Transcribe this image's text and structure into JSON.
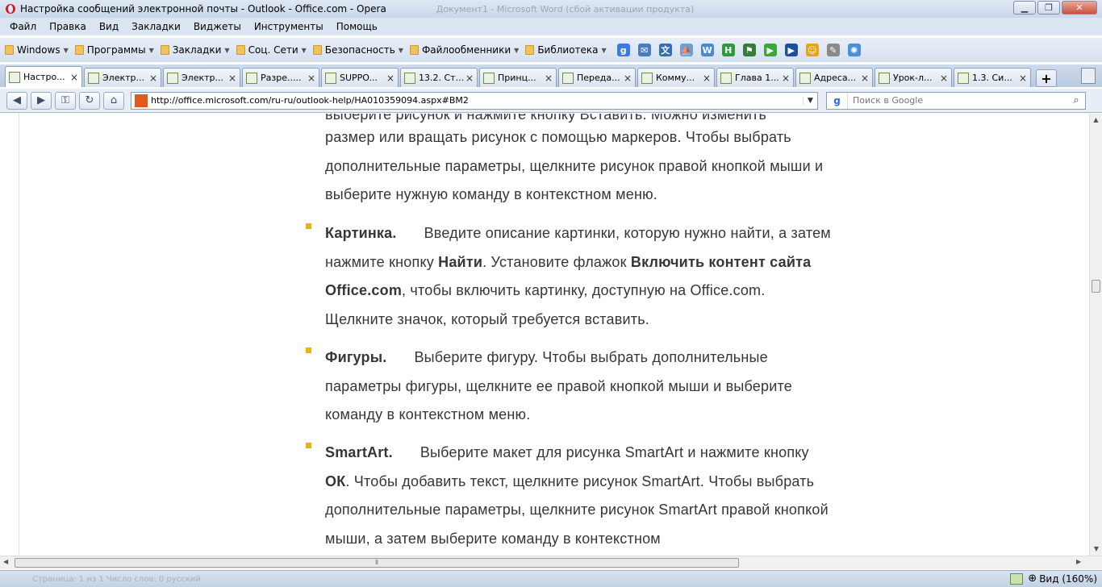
{
  "window": {
    "title": "Настройка сообщений электронной почты - Outlook - Office.com - Opera",
    "ghost_title": "Документ1 - Microsoft Word (сбой активации продукта)",
    "minimize": "▁",
    "maximize": "❐",
    "close": "✕"
  },
  "menu": [
    "Файл",
    "Правка",
    "Вид",
    "Закладки",
    "Виджеты",
    "Инструменты",
    "Помощь"
  ],
  "bookmarks": {
    "folders": [
      "Windows",
      "Программы",
      "Закладки",
      "Соц. Сети",
      "Безопасность",
      "Файлообменники",
      "Библиотека"
    ],
    "icons": [
      {
        "name": "google-icon",
        "glyph": "g",
        "color": "#3d7be0"
      },
      {
        "name": "mail-icon",
        "glyph": "✉",
        "color": "#4a7dc0"
      },
      {
        "name": "translate-icon",
        "glyph": "文",
        "color": "#2f6fb8"
      },
      {
        "name": "sail-icon",
        "glyph": "⛵",
        "color": "#6aa0d8"
      },
      {
        "name": "wikipedia-icon",
        "glyph": "W",
        "color": "#4a88d0"
      },
      {
        "name": "h-icon",
        "glyph": "H",
        "color": "#2e9a3c"
      },
      {
        "name": "flag-icon",
        "glyph": "⚑",
        "color": "#3a7a3a"
      },
      {
        "name": "play-icon",
        "glyph": "▶",
        "color": "#3aa83a"
      },
      {
        "name": "next-icon",
        "glyph": "▶",
        "color": "#1d4f9a"
      },
      {
        "name": "smiley-icon",
        "glyph": "☺",
        "color": "#e8a316"
      },
      {
        "name": "pen-icon",
        "glyph": "✎",
        "color": "#8a8a8a"
      },
      {
        "name": "flower-icon",
        "glyph": "✺",
        "color": "#4a8fd8"
      }
    ]
  },
  "tabs": [
    {
      "label": "Настро...",
      "active": true
    },
    {
      "label": "Электр...",
      "active": false
    },
    {
      "label": "Электр...",
      "active": false
    },
    {
      "label": "Разре.....",
      "active": false
    },
    {
      "label": "SUPPO...",
      "active": false
    },
    {
      "label": "13.2. Ст...",
      "active": false
    },
    {
      "label": "Принц...",
      "active": false
    },
    {
      "label": "Переда...",
      "active": false
    },
    {
      "label": "Комму...",
      "active": false
    },
    {
      "label": "Глава 1...",
      "active": false
    },
    {
      "label": "Адреса...",
      "active": false
    },
    {
      "label": "Урок-л...",
      "active": false
    },
    {
      "label": "1.3. Си...",
      "active": false
    }
  ],
  "tab_close": "×",
  "new_tab": "+",
  "address": {
    "url": "http://office.microsoft.com/ru-ru/outlook-help/HA010359094.aspx#BM2"
  },
  "search": {
    "engine": "g",
    "placeholder": "Поиск в Google"
  },
  "content": {
    "top_partial": "выберите рисунок и нажмите кнопку Вставить. Можно изменить",
    "intro_lines": "размер или вращать рисунок с помощью маркеров. Чтобы выбрать дополнительные параметры, щелкните рисунок правой кнопкой мыши и выберите нужную команду в контекстном меню.",
    "item1": {
      "term": "Картинка.",
      "text_a": "Введите описание картинки, которую нужно найти, а затем нажмите кнопку ",
      "bold_a": "Найти",
      "text_b": ". Установите флажок ",
      "bold_b": "Включить контент сайта Office.com",
      "text_c": ", чтобы включить картинку, доступную на Office.com. Щелкните значок, который требуется вставить."
    },
    "item2": {
      "term": "Фигуры.",
      "text": "Выберите фигуру. Чтобы выбрать дополнительные параметры фигуры, щелкните ее правой кнопкой мыши и выберите команду в контекстном меню."
    },
    "item3": {
      "term": "SmartArt.",
      "text_a": "Выберите макет для рисунка SmartArt и нажмите кнопку ",
      "bold_a": "ОК",
      "text_b": ". Чтобы добавить текст, щелкните рисунок SmartArt. Чтобы выбрать дополнительные параметры, щелкните рисунок SmartArt правой кнопкой мыши, а затем выберите команду в контекстном"
    }
  },
  "status": {
    "ghost": "Страница: 1 из 1    Число слов: 0    русский",
    "zoom_label": "Вид (160%)",
    "zoom_value": 160
  },
  "colors": {
    "bullet": "#f0b400",
    "text": "#363636",
    "chrome": "#dbe5f1"
  }
}
